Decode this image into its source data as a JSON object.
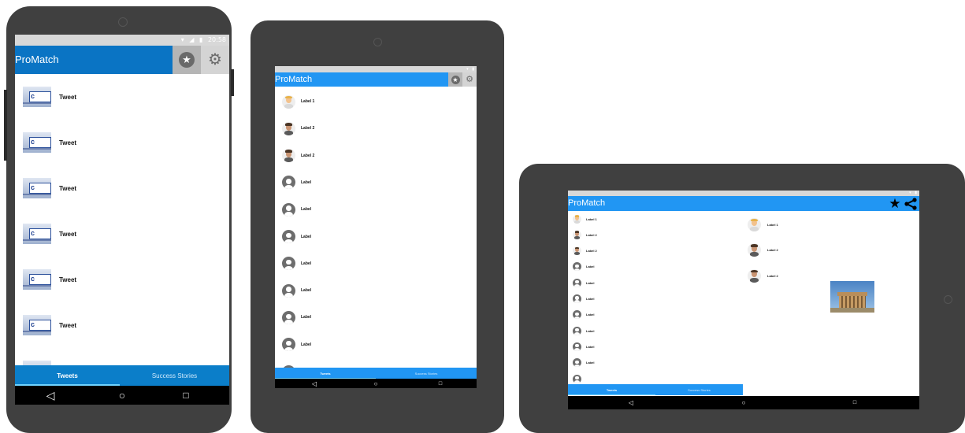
{
  "phone": {
    "status_time": "20:58",
    "app_title": "ProMatch",
    "list": [
      {
        "thumb": "collabo",
        "label": "Tweet"
      },
      {
        "thumb": "collabo",
        "label": "Tweet"
      },
      {
        "thumb": "collabo",
        "label": "Tweet"
      },
      {
        "thumb": "collabo",
        "label": "Tweet"
      },
      {
        "thumb": "collabo",
        "label": "Tweet"
      },
      {
        "thumb": "collabo",
        "label": "Tweet"
      }
    ],
    "tabs": [
      "Tweets",
      "Success Stories"
    ]
  },
  "tablet": {
    "app_title": "ProMatch",
    "list": [
      {
        "avatar": "person-blonde",
        "label": "Label 1"
      },
      {
        "avatar": "person-man",
        "label": "Label 2"
      },
      {
        "avatar": "person-man",
        "label": "Label 2"
      },
      {
        "avatar": "generic",
        "label": "Label"
      },
      {
        "avatar": "generic",
        "label": "Label"
      },
      {
        "avatar": "generic",
        "label": "Label"
      },
      {
        "avatar": "generic",
        "label": "Label"
      },
      {
        "avatar": "generic",
        "label": "Label"
      },
      {
        "avatar": "generic",
        "label": "Label"
      },
      {
        "avatar": "generic",
        "label": "Label"
      }
    ],
    "tabs": [
      "Tweets",
      "Success Stories"
    ]
  },
  "landscape": {
    "app_title": "ProMatch",
    "left_list": [
      {
        "avatar": "person-blonde",
        "label": "Label 1"
      },
      {
        "avatar": "person-man",
        "label": "Label 2"
      },
      {
        "avatar": "person-man",
        "label": "Label 2"
      },
      {
        "avatar": "generic",
        "label": "Label"
      },
      {
        "avatar": "generic",
        "label": "Label"
      },
      {
        "avatar": "generic",
        "label": "Label"
      },
      {
        "avatar": "generic",
        "label": "Label"
      },
      {
        "avatar": "generic",
        "label": "Label"
      },
      {
        "avatar": "generic",
        "label": "Label"
      },
      {
        "avatar": "generic",
        "label": "Label"
      }
    ],
    "right_list": [
      {
        "avatar": "person-blonde",
        "label": "Label 1"
      },
      {
        "avatar": "person-man",
        "label": "Label 2"
      },
      {
        "avatar": "person-man",
        "label": "Label 2"
      }
    ],
    "tabs": [
      "Tweets",
      "Success Stories"
    ]
  },
  "colors": {
    "phone_appbar": "#0a74c4",
    "tablet_appbar": "#2196f3",
    "tab_active_indicator": "#6fd3ff",
    "device_frame": "#404040"
  }
}
